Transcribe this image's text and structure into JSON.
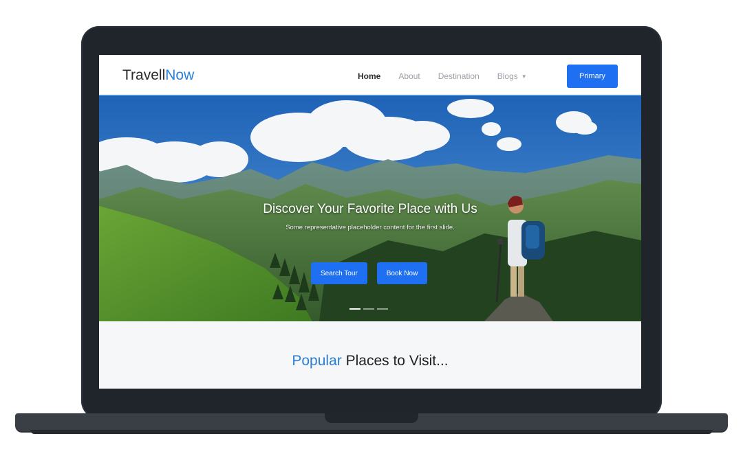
{
  "brand": {
    "part1": "Travell",
    "part2": "Now"
  },
  "nav": {
    "items": [
      {
        "label": "Home"
      },
      {
        "label": "About"
      },
      {
        "label": "Destination"
      },
      {
        "label": "Blogs"
      }
    ],
    "primary_label": "Primary"
  },
  "hero": {
    "title": "Discover Your Favorite Place with Us",
    "subtitle": "Some representative placeholder content for the first slide.",
    "buttons": [
      "Search Tour",
      "Book Now"
    ],
    "slide_count": 3,
    "active_slide": 1
  },
  "section": {
    "title_highlight": "Popular",
    "title_rest": " Places to Visit..."
  },
  "colors": {
    "accent": "#1e6ff2",
    "brand_highlight": "#2a80d8",
    "frame": "#20252b"
  }
}
